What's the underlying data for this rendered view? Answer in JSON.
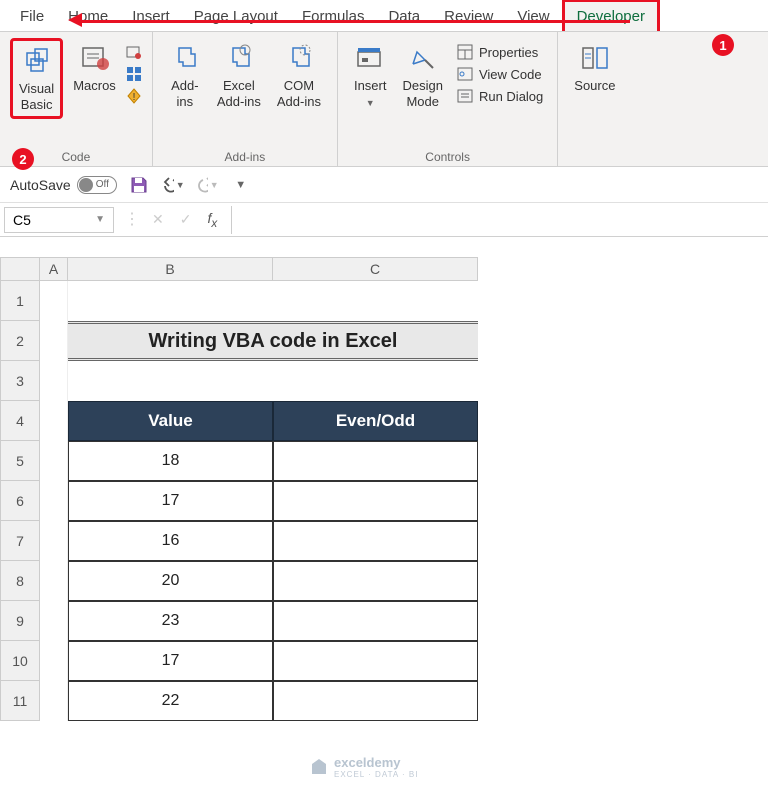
{
  "tabs": [
    "File",
    "Home",
    "Insert",
    "Page Layout",
    "Formulas",
    "Data",
    "Review",
    "View",
    "Developer"
  ],
  "active_tab": "Developer",
  "ribbon": {
    "code": {
      "vb": "Visual\nBasic",
      "macros": "Macros",
      "label": "Code"
    },
    "addins": {
      "addins": "Add-\nins",
      "excel": "Excel\nAdd-ins",
      "com": "COM\nAdd-ins",
      "label": "Add-ins"
    },
    "controls": {
      "insert": "Insert",
      "design": "Design\nMode",
      "properties": "Properties",
      "viewcode": "View Code",
      "rundialog": "Run Dialog",
      "label": "Controls"
    },
    "xml": {
      "source": "Source"
    }
  },
  "qat": {
    "autosave": "AutoSave",
    "off": "Off"
  },
  "namebox": "C5",
  "sheet": {
    "title": "Writing VBA code in Excel",
    "headers": {
      "b": "Value",
      "c": "Even/Odd"
    },
    "rows": [
      {
        "n": "1"
      },
      {
        "n": "2"
      },
      {
        "n": "3"
      },
      {
        "n": "4"
      },
      {
        "n": "5",
        "b": "18",
        "c": ""
      },
      {
        "n": "6",
        "b": "17",
        "c": ""
      },
      {
        "n": "7",
        "b": "16",
        "c": ""
      },
      {
        "n": "8",
        "b": "20",
        "c": ""
      },
      {
        "n": "9",
        "b": "23",
        "c": ""
      },
      {
        "n": "10",
        "b": "17",
        "c": ""
      },
      {
        "n": "11",
        "b": "22",
        "c": ""
      }
    ],
    "cols": [
      "A",
      "B",
      "C"
    ]
  },
  "callouts": {
    "1": "1",
    "2": "2"
  },
  "watermark": {
    "name": "exceldemy",
    "sub": "EXCEL · DATA · BI"
  }
}
